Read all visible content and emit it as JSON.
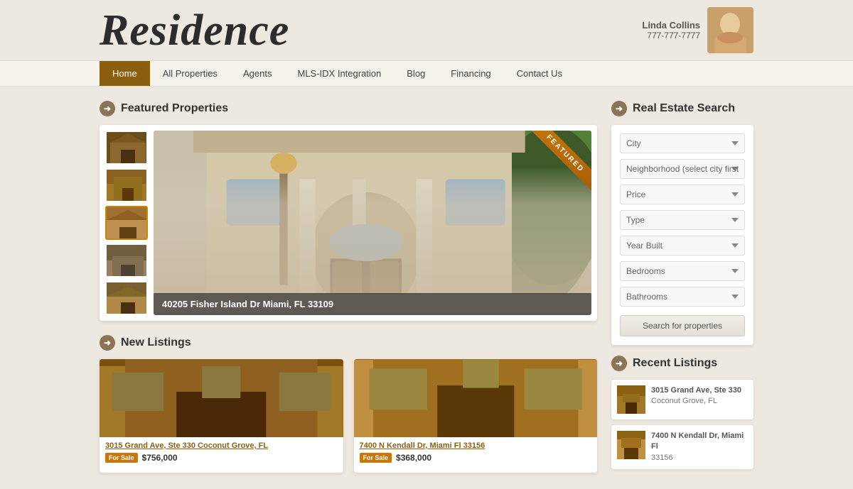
{
  "header": {
    "logo": "Residence",
    "agent": {
      "name": "Linda Collins",
      "phone": "777-777-7777"
    }
  },
  "nav": {
    "items": [
      {
        "label": "Home",
        "active": true
      },
      {
        "label": "All Properties",
        "active": false
      },
      {
        "label": "Agents",
        "active": false
      },
      {
        "label": "MLS-IDX Integration",
        "active": false
      },
      {
        "label": "Blog",
        "active": false
      },
      {
        "label": "Financing",
        "active": false
      },
      {
        "label": "Contact Us",
        "active": false
      }
    ]
  },
  "featured": {
    "section_title": "Featured Properties",
    "ribbon_text": "FEATURED",
    "main_address": "40205 Fisher Island Dr Miami, FL 33109",
    "thumbnails": [
      {
        "id": 1,
        "active": false
      },
      {
        "id": 2,
        "active": false
      },
      {
        "id": 3,
        "active": true
      },
      {
        "id": 4,
        "active": false
      },
      {
        "id": 5,
        "active": false
      }
    ]
  },
  "new_listings": {
    "section_title": "New Listings",
    "items": [
      {
        "address": "3015 Grand Ave, Ste 330 Coconut Grove, FL",
        "tag": "For Sale",
        "price": "$756,000"
      },
      {
        "address": "7400 N Kendall Dr, Miami Fl 33156",
        "tag": "For Sale",
        "price": "$368,000"
      }
    ]
  },
  "search": {
    "section_title": "Real Estate Search",
    "fields": [
      {
        "name": "city",
        "placeholder": "City"
      },
      {
        "name": "neighborhood",
        "placeholder": "Neighborhood (select city first)"
      },
      {
        "name": "price",
        "placeholder": "Price"
      },
      {
        "name": "type",
        "placeholder": "Type"
      },
      {
        "name": "year_built",
        "placeholder": "Year Built"
      },
      {
        "name": "bedrooms",
        "placeholder": "Bedrooms"
      },
      {
        "name": "bathrooms",
        "placeholder": "Bathrooms"
      }
    ],
    "button_label": "Search for properties"
  },
  "recent_listings": {
    "section_title": "Recent Listings",
    "items": [
      {
        "address": "3015 Grand Ave, Ste 330",
        "city": "Coconut Grove, FL"
      },
      {
        "address": "7400 N Kendall Dr, Miami Fl",
        "city": "33156"
      }
    ]
  }
}
